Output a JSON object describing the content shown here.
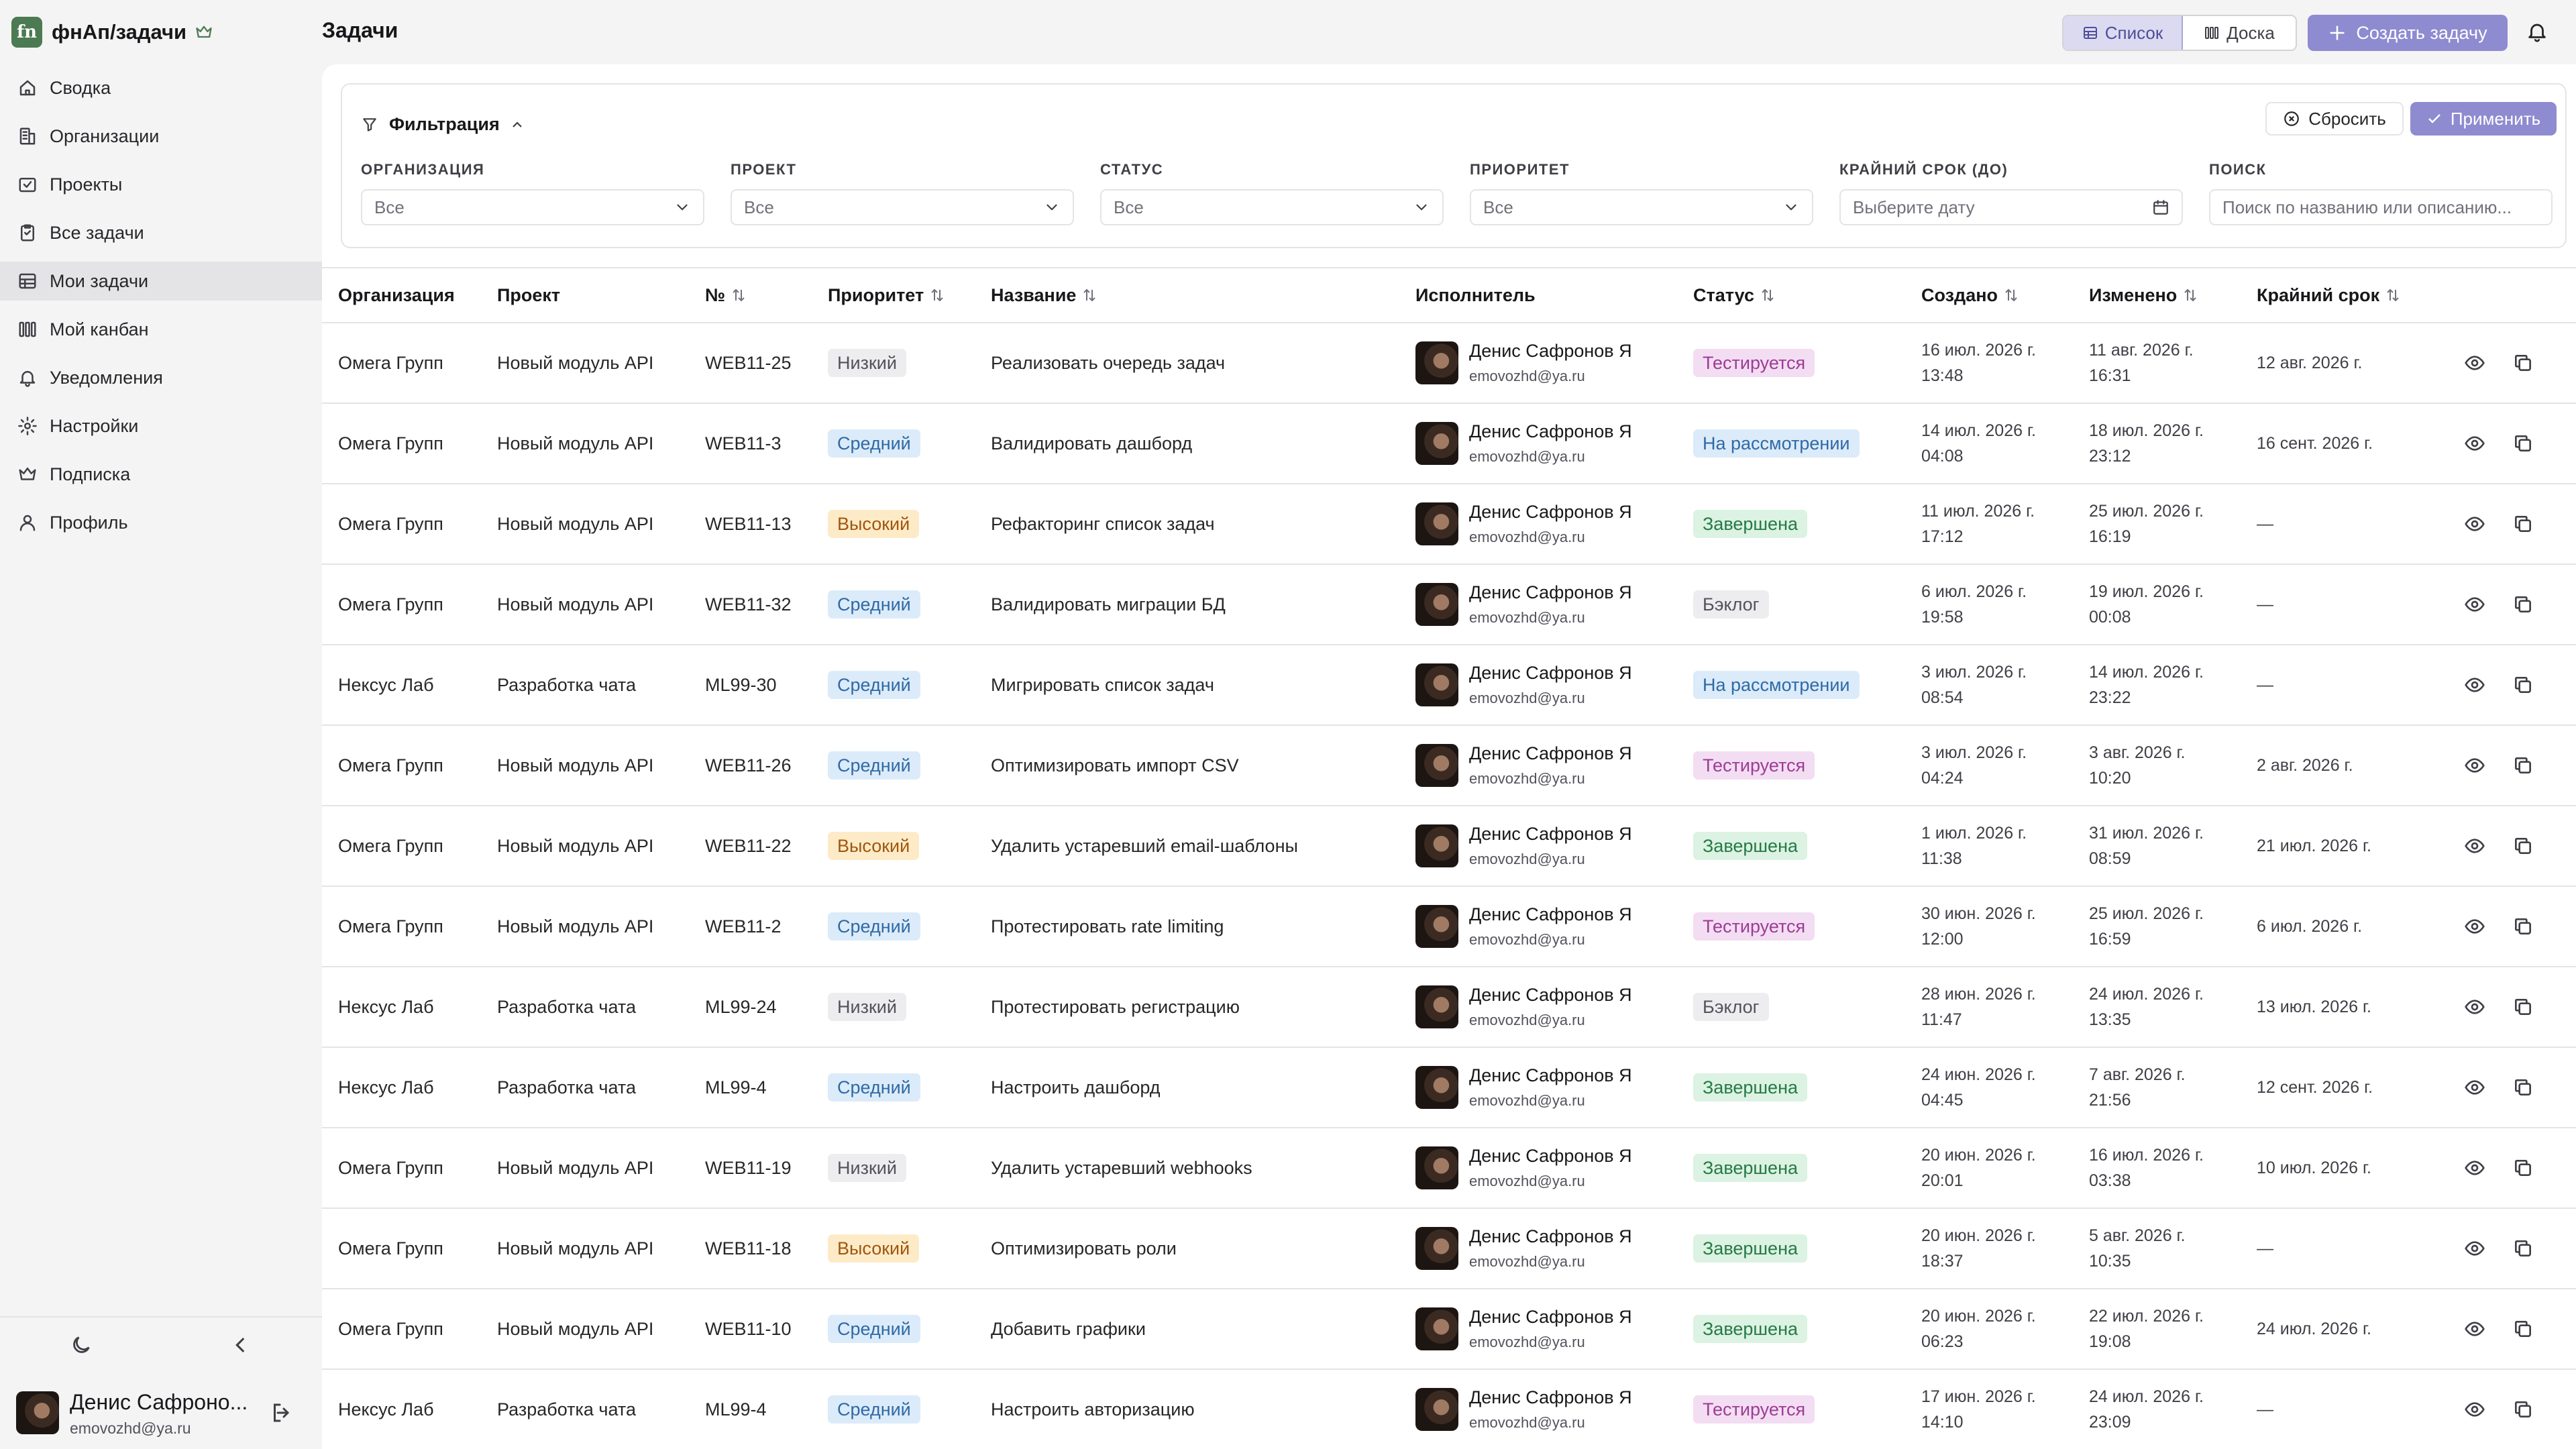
{
  "app": {
    "brand_logo": "fn",
    "brand_name": "фнАп/задачи",
    "crown_icon": "crown-icon",
    "accent": "#8f8bd0",
    "brand_color": "#4c7a52"
  },
  "sidebar": {
    "items": [
      {
        "label": "Сводка",
        "icon": "home-icon"
      },
      {
        "label": "Организации",
        "icon": "building-icon"
      },
      {
        "label": "Проекты",
        "icon": "folder-check-icon"
      },
      {
        "label": "Все задачи",
        "icon": "clipboard-icon"
      },
      {
        "label": "Мои задачи",
        "icon": "table-icon",
        "active": true
      },
      {
        "label": "Мой канбан",
        "icon": "columns-icon"
      },
      {
        "label": "Уведомления",
        "icon": "bell-icon"
      },
      {
        "label": "Настройки",
        "icon": "gear-icon"
      },
      {
        "label": "Подписка",
        "icon": "crown-icon"
      },
      {
        "label": "Профиль",
        "icon": "user-icon"
      }
    ],
    "user": {
      "name": "Денис Сафроно...",
      "email": "emovozhd@ya.ru"
    }
  },
  "header": {
    "title": "Задачи",
    "view_list": "Список",
    "view_board": "Доска",
    "create": "Создать задачу"
  },
  "filters": {
    "title": "Фильтрация",
    "reset": "Сбросить",
    "apply": "Применить",
    "fields": [
      {
        "label": "ОРГАНИЗАЦИЯ",
        "value": "Все",
        "type": "select"
      },
      {
        "label": "ПРОЕКТ",
        "value": "Все",
        "type": "select"
      },
      {
        "label": "СТАТУС",
        "value": "Все",
        "type": "select"
      },
      {
        "label": "ПРИОРИТЕТ",
        "value": "Все",
        "type": "select"
      },
      {
        "label": "КРАЙНИЙ СРОК (ДО)",
        "value": "Выберите дату",
        "type": "date"
      },
      {
        "label": "ПОИСК",
        "value": "Поиск по названию или описанию...",
        "type": "search"
      }
    ]
  },
  "table": {
    "columns": {
      "org": "Организация",
      "project": "Проект",
      "num": "№",
      "priority": "Приоритет",
      "name": "Название",
      "assignee": "Исполнитель",
      "status": "Статус",
      "created": "Создано",
      "updated": "Изменено",
      "deadline": "Крайний срок"
    },
    "rows": [
      {
        "org": "Омега Групп",
        "project": "Новый модуль API",
        "num": "WEB11-25",
        "priority": "Низкий",
        "pclass": "pri-low",
        "name": "Реализовать очередь задач",
        "assignee": "Денис Сафронов Я",
        "email": "emovozhd@ya.ru",
        "status": "Тестируется",
        "sclass": "st-test",
        "created_d": "16 июл. 2026 г.",
        "created_t": "13:48",
        "updated_d": "11 авг. 2026 г.",
        "updated_t": "16:31",
        "deadline": "12 авг. 2026 г."
      },
      {
        "org": "Омега Групп",
        "project": "Новый модуль API",
        "num": "WEB11-3",
        "priority": "Средний",
        "pclass": "pri-mid",
        "name": "Валидировать дашборд",
        "assignee": "Денис Сафронов Я",
        "email": "emovozhd@ya.ru",
        "status": "На рассмотрении",
        "sclass": "st-review",
        "created_d": "14 июл. 2026 г.",
        "created_t": "04:08",
        "updated_d": "18 июл. 2026 г.",
        "updated_t": "23:12",
        "deadline": "16 сент. 2026 г."
      },
      {
        "org": "Омега Групп",
        "project": "Новый модуль API",
        "num": "WEB11-13",
        "priority": "Высокий",
        "pclass": "pri-high",
        "name": "Рефакторинг список задач",
        "assignee": "Денис Сафронов Я",
        "email": "emovozhd@ya.ru",
        "status": "Завершена",
        "sclass": "st-done",
        "created_d": "11 июл. 2026 г.",
        "created_t": "17:12",
        "updated_d": "25 июл. 2026 г.",
        "updated_t": "16:19",
        "deadline": "—"
      },
      {
        "org": "Омега Групп",
        "project": "Новый модуль API",
        "num": "WEB11-32",
        "priority": "Средний",
        "pclass": "pri-mid",
        "name": "Валидировать миграции БД",
        "assignee": "Денис Сафронов Я",
        "email": "emovozhd@ya.ru",
        "status": "Бэклог",
        "sclass": "st-backlog",
        "created_d": "6 июл. 2026 г.",
        "created_t": "19:58",
        "updated_d": "19 июл. 2026 г.",
        "updated_t": "00:08",
        "deadline": "—"
      },
      {
        "org": "Нексус Лаб",
        "project": "Разработка чата",
        "num": "ML99-30",
        "priority": "Средний",
        "pclass": "pri-mid",
        "name": "Мигрировать список задач",
        "assignee": "Денис Сафронов Я",
        "email": "emovozhd@ya.ru",
        "status": "На рассмотрении",
        "sclass": "st-review",
        "created_d": "3 июл. 2026 г.",
        "created_t": "08:54",
        "updated_d": "14 июл. 2026 г.",
        "updated_t": "23:22",
        "deadline": "—"
      },
      {
        "org": "Омега Групп",
        "project": "Новый модуль API",
        "num": "WEB11-26",
        "priority": "Средний",
        "pclass": "pri-mid",
        "name": "Оптимизировать импорт CSV",
        "assignee": "Денис Сафронов Я",
        "email": "emovozhd@ya.ru",
        "status": "Тестируется",
        "sclass": "st-test",
        "created_d": "3 июл. 2026 г.",
        "created_t": "04:24",
        "updated_d": "3 авг. 2026 г.",
        "updated_t": "10:20",
        "deadline": "2 авг. 2026 г."
      },
      {
        "org": "Омега Групп",
        "project": "Новый модуль API",
        "num": "WEB11-22",
        "priority": "Высокий",
        "pclass": "pri-high",
        "name": "Удалить устаревший email-шаблоны",
        "assignee": "Денис Сафронов Я",
        "email": "emovozhd@ya.ru",
        "status": "Завершена",
        "sclass": "st-done",
        "created_d": "1 июл. 2026 г.",
        "created_t": "11:38",
        "updated_d": "31 июл. 2026 г.",
        "updated_t": "08:59",
        "deadline": "21 июл. 2026 г."
      },
      {
        "org": "Омега Групп",
        "project": "Новый модуль API",
        "num": "WEB11-2",
        "priority": "Средний",
        "pclass": "pri-mid",
        "name": "Протестировать rate limiting",
        "assignee": "Денис Сафронов Я",
        "email": "emovozhd@ya.ru",
        "status": "Тестируется",
        "sclass": "st-test",
        "created_d": "30 июн. 2026 г.",
        "created_t": "12:00",
        "updated_d": "25 июл. 2026 г.",
        "updated_t": "16:59",
        "deadline": "6 июл. 2026 г."
      },
      {
        "org": "Нексус Лаб",
        "project": "Разработка чата",
        "num": "ML99-24",
        "priority": "Низкий",
        "pclass": "pri-low",
        "name": "Протестировать регистрацию",
        "assignee": "Денис Сафронов Я",
        "email": "emovozhd@ya.ru",
        "status": "Бэклог",
        "sclass": "st-backlog",
        "created_d": "28 июн. 2026 г.",
        "created_t": "11:47",
        "updated_d": "24 июл. 2026 г.",
        "updated_t": "13:35",
        "deadline": "13 июл. 2026 г."
      },
      {
        "org": "Нексус Лаб",
        "project": "Разработка чата",
        "num": "ML99-4",
        "priority": "Средний",
        "pclass": "pri-mid",
        "name": "Настроить дашборд",
        "assignee": "Денис Сафронов Я",
        "email": "emovozhd@ya.ru",
        "status": "Завершена",
        "sclass": "st-done",
        "created_d": "24 июн. 2026 г.",
        "created_t": "04:45",
        "updated_d": "7 авг. 2026 г.",
        "updated_t": "21:56",
        "deadline": "12 сент. 2026 г."
      },
      {
        "org": "Омега Групп",
        "project": "Новый модуль API",
        "num": "WEB11-19",
        "priority": "Низкий",
        "pclass": "pri-low",
        "name": "Удалить устаревший webhooks",
        "assignee": "Денис Сафронов Я",
        "email": "emovozhd@ya.ru",
        "status": "Завершена",
        "sclass": "st-done",
        "created_d": "20 июн. 2026 г.",
        "created_t": "20:01",
        "updated_d": "16 июл. 2026 г.",
        "updated_t": "03:38",
        "deadline": "10 июл. 2026 г."
      },
      {
        "org": "Омега Групп",
        "project": "Новый модуль API",
        "num": "WEB11-18",
        "priority": "Высокий",
        "pclass": "pri-high",
        "name": "Оптимизировать роли",
        "assignee": "Денис Сафронов Я",
        "email": "emovozhd@ya.ru",
        "status": "Завершена",
        "sclass": "st-done",
        "created_d": "20 июн. 2026 г.",
        "created_t": "18:37",
        "updated_d": "5 авг. 2026 г.",
        "updated_t": "10:35",
        "deadline": "—"
      },
      {
        "org": "Омега Групп",
        "project": "Новый модуль API",
        "num": "WEB11-10",
        "priority": "Средний",
        "pclass": "pri-mid",
        "name": "Добавить графики",
        "assignee": "Денис Сафронов Я",
        "email": "emovozhd@ya.ru",
        "status": "Завершена",
        "sclass": "st-done",
        "created_d": "20 июн. 2026 г.",
        "created_t": "06:23",
        "updated_d": "22 июл. 2026 г.",
        "updated_t": "19:08",
        "deadline": "24 июл. 2026 г."
      },
      {
        "org": "Нексус Лаб",
        "project": "Разработка чата",
        "num": "ML99-4",
        "priority": "Средний",
        "pclass": "pri-mid",
        "name": "Настроить авторизацию",
        "assignee": "Денис Сафронов Я",
        "email": "emovozhd@ya.ru",
        "status": "Тестируется",
        "sclass": "st-test",
        "created_d": "17 июн. 2026 г.",
        "created_t": "14:10",
        "updated_d": "24 июл. 2026 г.",
        "updated_t": "23:09",
        "deadline": "—"
      }
    ]
  }
}
